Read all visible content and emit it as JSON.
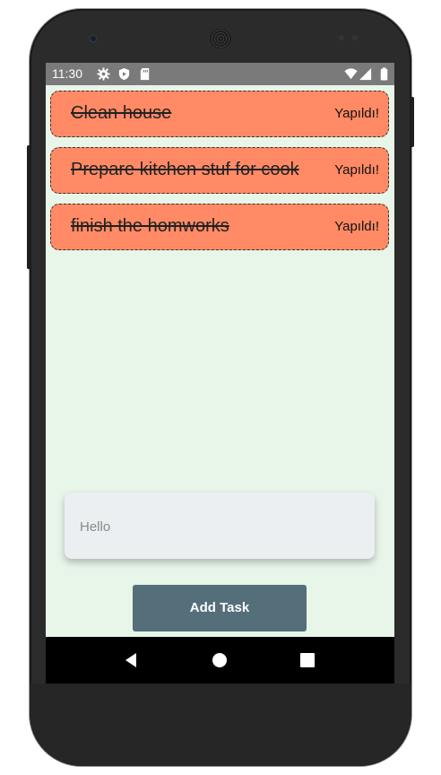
{
  "statusbar": {
    "time": "11:30",
    "icons": [
      "settings-gear-icon",
      "play-protect-icon",
      "sd-card-icon",
      "wifi-icon",
      "cell-signal-icon",
      "battery-icon"
    ]
  },
  "tasks": [
    {
      "text": "Clean  house",
      "done_label": "Yapıldı!",
      "completed": true
    },
    {
      "text": "Prepare kitchen stuf for cook",
      "done_label": "Yapıldı!",
      "completed": true
    },
    {
      "text": "finish the homworks",
      "done_label": "Yapıldı!",
      "completed": true
    }
  ],
  "input": {
    "placeholder": "Hello",
    "value": ""
  },
  "add_button": {
    "label": "Add Task"
  },
  "navbar": {
    "icons": [
      "back-icon",
      "home-icon",
      "recents-icon"
    ]
  },
  "colors": {
    "background": "#e8f5e9",
    "task_card": "#ff8a65",
    "button": "#546e7a",
    "input": "#eceff1",
    "statusbar": "#7a7a7a",
    "navbar": "#000000"
  }
}
